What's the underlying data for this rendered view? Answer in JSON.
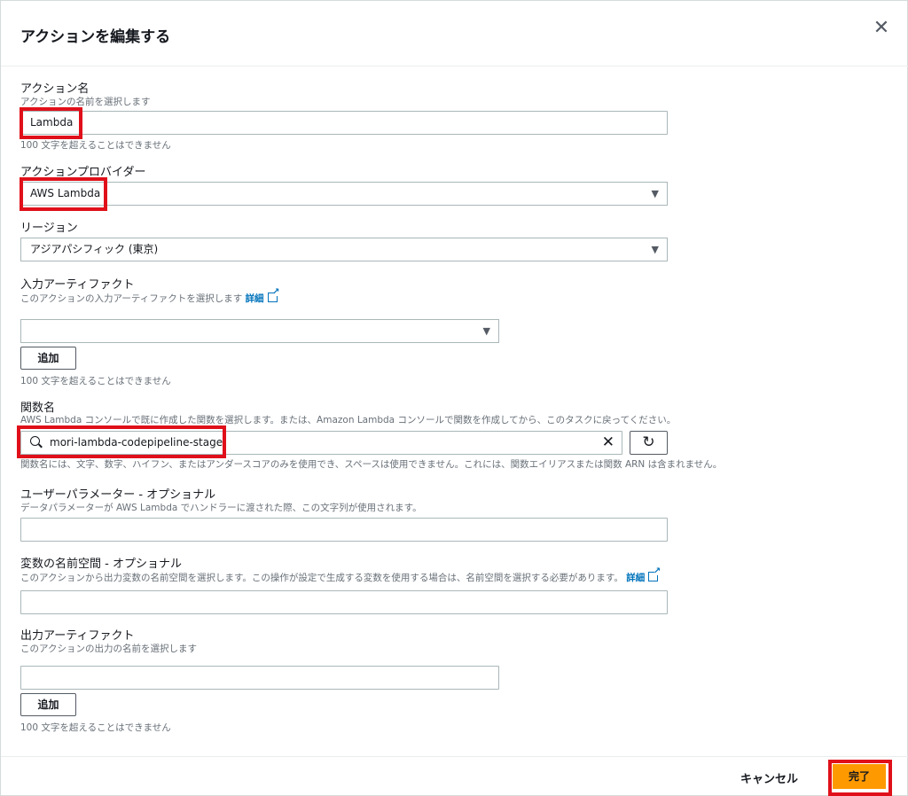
{
  "modal": {
    "title": "アクションを編集する",
    "close_icon": "close-icon"
  },
  "action_name": {
    "label": "アクション名",
    "description": "アクションの名前を選択します",
    "value": "Lambda",
    "hint": "100 文字を超えることはできません"
  },
  "action_provider": {
    "label": "アクションプロバイダー",
    "value": "AWS Lambda"
  },
  "region": {
    "label": "リージョン",
    "value": "アジアパシフィック (東京)"
  },
  "input_artifacts": {
    "label": "入力アーティファクト",
    "description": "このアクションの入力アーティファクトを選択します",
    "info_link": "詳細",
    "value": "",
    "add_button": "追加",
    "hint": "100 文字を超えることはできません"
  },
  "function_name": {
    "label": "関数名",
    "description": "AWS Lambda コンソールで既に作成した関数を選択します。または、Amazon Lambda コンソールで関数を作成してから、このタスクに戻ってください。",
    "value": "mori-lambda-codepipeline-stage",
    "hint": "関数名には、文字、数字、ハイフン、またはアンダースコアのみを使用でき、スペースは使用できません。これには、関数エイリアスまたは関数 ARN は含まれません。"
  },
  "user_parameters": {
    "label": "ユーザーパラメーター - オプショナル",
    "description": "データパラメーターが AWS Lambda でハンドラーに渡された際、この文字列が使用されます。",
    "value": ""
  },
  "variable_namespace": {
    "label": "変数の名前空間 - オプショナル",
    "description": "このアクションから出力変数の名前空間を選択します。この操作が設定で生成する変数を使用する場合は、名前空間を選択する必要があります。",
    "info_link": "詳細",
    "value": ""
  },
  "output_artifacts": {
    "label": "出力アーティファクト",
    "description": "このアクションの出力の名前を選択します",
    "value": "",
    "add_button": "追加",
    "hint": "100 文字を超えることはできません"
  },
  "footer": {
    "cancel": "キャンセル",
    "done": "完了"
  },
  "colors": {
    "primary": "#ff9900",
    "highlight": "#e0101a",
    "link": "#0073bb"
  }
}
